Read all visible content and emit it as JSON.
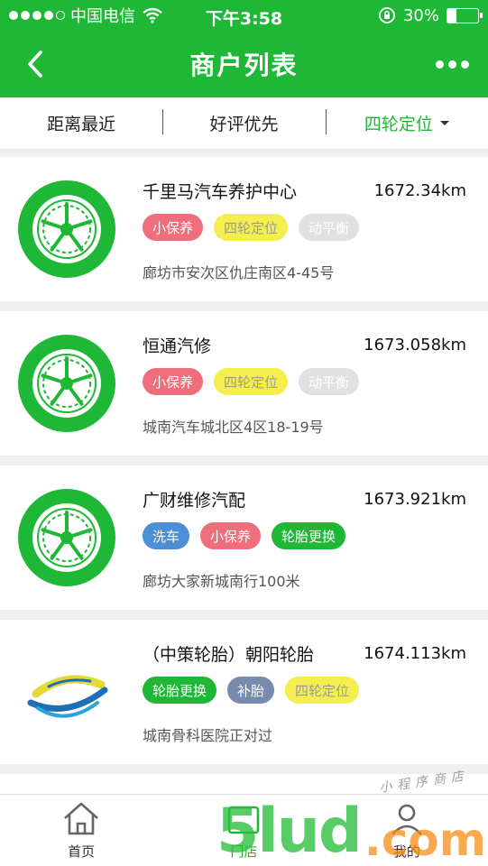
{
  "status_bar": {
    "carrier": "中国电信",
    "time": "下午3:58",
    "battery": "30%",
    "battery_level": 0.3
  },
  "nav": {
    "title": "商户列表"
  },
  "filters": [
    {
      "label": "距离最近",
      "active": false
    },
    {
      "label": "好评优先",
      "active": false
    },
    {
      "label": "四轮定位",
      "active": true
    }
  ],
  "shops": [
    {
      "name": "千里马汽车养护中心",
      "distance": "1672.34km",
      "logo": "tire",
      "tags": [
        {
          "label": "小保养",
          "color": "pink"
        },
        {
          "label": "四轮定位",
          "color": "yellow"
        },
        {
          "label": "动平衡",
          "color": "gray"
        }
      ],
      "address": "廊坊市安次区仇庄南区4-45号"
    },
    {
      "name": "恒通汽修",
      "distance": "1673.058km",
      "logo": "tire",
      "tags": [
        {
          "label": "小保养",
          "color": "pink"
        },
        {
          "label": "四轮定位",
          "color": "yellow"
        },
        {
          "label": "动平衡",
          "color": "gray"
        }
      ],
      "address": "城南汽车城北区4区18-19号"
    },
    {
      "name": "广财维修汽配",
      "distance": "1673.921km",
      "logo": "tire",
      "tags": [
        {
          "label": "洗车",
          "color": "blue"
        },
        {
          "label": "小保养",
          "color": "pink"
        },
        {
          "label": "轮胎更换",
          "color": "green"
        }
      ],
      "address": "廊坊大家新城南行100米"
    },
    {
      "name": "（中策轮胎）朝阳轮胎",
      "distance": "1674.113km",
      "logo": "globe",
      "tags": [
        {
          "label": "轮胎更换",
          "color": "green"
        },
        {
          "label": "补胎",
          "color": "slate"
        },
        {
          "label": "四轮定位",
          "color": "yellow"
        }
      ],
      "address": "城南骨科医院正对过"
    }
  ],
  "tabs": [
    {
      "label": "首页",
      "icon": "home-icon",
      "active": false
    },
    {
      "label": "门店",
      "icon": "store-icon",
      "active": true
    },
    {
      "label": "我的",
      "icon": "user-icon",
      "active": false
    }
  ],
  "watermark": {
    "main": "5lud",
    "suffix": ".com",
    "sub": "小程序商店"
  },
  "colors": {
    "brand_green": "#1fb836",
    "tag_pink": "#ef6e7c",
    "tag_yellow": "#f4ef4e",
    "tag_gray": "#e1e1e1",
    "tag_blue": "#4b8fd6",
    "tag_slate": "#768bad"
  }
}
